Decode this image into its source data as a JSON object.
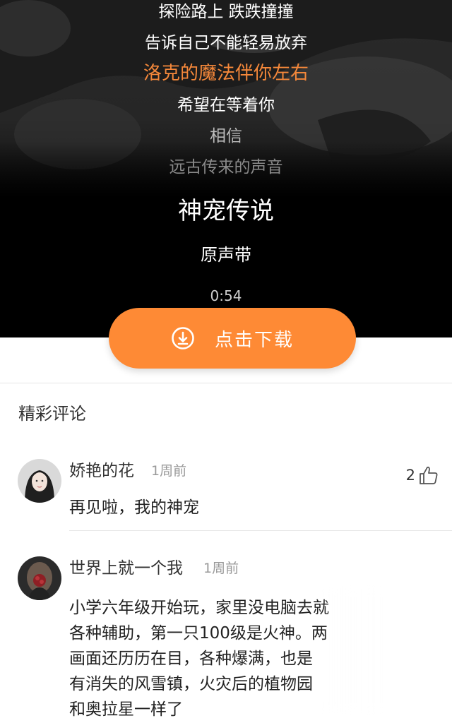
{
  "lyrics": [
    "探险路上 跌跌撞撞",
    "告诉自己不能轻易放弃",
    "洛克的魔法伴你左右",
    "希望在等着你",
    "相信",
    "远古传来的声音"
  ],
  "song": {
    "title": "神宠传说",
    "subtitle": "原声带",
    "time": "0:54"
  },
  "download": {
    "label": "点击下载",
    "icon": "download-circle-icon",
    "color": "#fe8a35"
  },
  "comments_section": {
    "title": "精彩评论",
    "items": [
      {
        "name": "娇艳的花",
        "time": "1周前",
        "likes": "2",
        "text": "再见啦，我的神宠"
      },
      {
        "name": "世界上就一个我",
        "time": "1周前",
        "lines": [
          "小学六年级开始玩，家里没电脑去就",
          "各种辅助，第一只100级是火神。两",
          "画面还历历在目，各种爆满，也是",
          "有消失的风雪镇，火灾后的植物园",
          "和奥拉星一样了"
        ]
      }
    ]
  },
  "colors": {
    "accent": "#f5883a",
    "hero_bg": "#000000"
  }
}
